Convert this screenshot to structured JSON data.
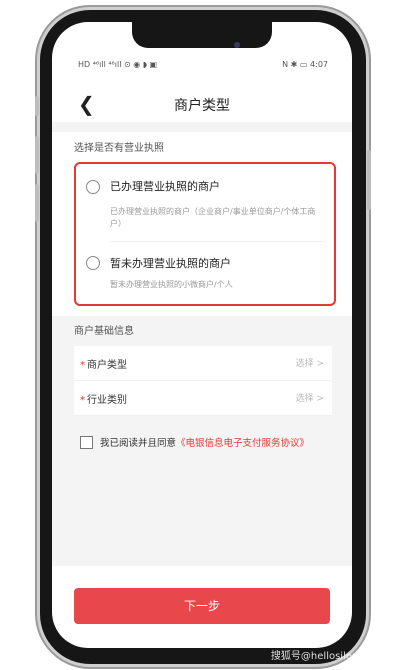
{
  "status_bar": {
    "left": "HD ⁴⁶ıll ⁴⁶ıll ⊙ ◉ ◗ ▣",
    "right": "N ✱ ▭ 4:07"
  },
  "nav": {
    "title": "商户类型",
    "back_icon": "chevron-left-icon"
  },
  "license_section": {
    "heading": "选择是否有营业执照",
    "options": [
      {
        "title": "已办理营业执照的商户",
        "desc": "已办理营业执照的商户（企业商户/事业单位商户/个体工商户）"
      },
      {
        "title": "暂未办理营业执照的商户",
        "desc": "暂未办理营业执照的小微商户/个人"
      }
    ]
  },
  "basic_section": {
    "heading": "商户基础信息",
    "rows": [
      {
        "label": "商户类型",
        "placeholder": "选择 >"
      },
      {
        "label": "行业类别",
        "placeholder": "选择 >"
      }
    ]
  },
  "agreement": {
    "text": "我已阅读并且同意",
    "link": "《电银信息电子支付服务协议》"
  },
  "next_button": "下一步",
  "watermark": "搜狐号@hellosilence",
  "colors": {
    "accent": "#e53935",
    "button": "#e8474c"
  }
}
